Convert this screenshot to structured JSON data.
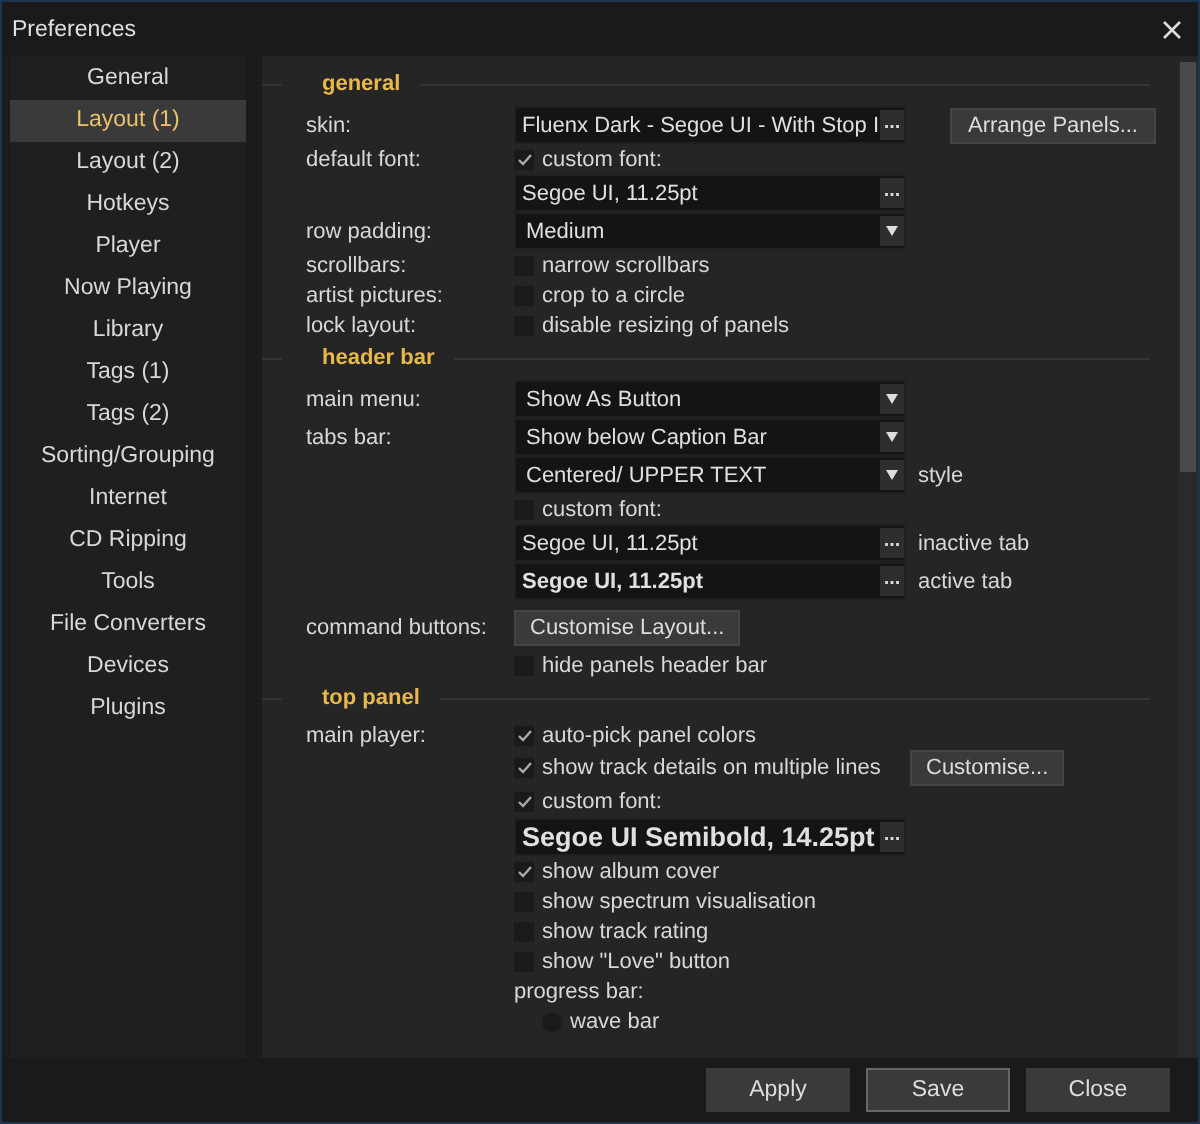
{
  "window": {
    "title": "Preferences"
  },
  "sidebar": {
    "items": [
      {
        "label": "General",
        "selected": false
      },
      {
        "label": "Layout (1)",
        "selected": true
      },
      {
        "label": "Layout (2)",
        "selected": false
      },
      {
        "label": "Hotkeys",
        "selected": false
      },
      {
        "label": "Player",
        "selected": false
      },
      {
        "label": "Now Playing",
        "selected": false
      },
      {
        "label": "Library",
        "selected": false
      },
      {
        "label": "Tags (1)",
        "selected": false
      },
      {
        "label": "Tags (2)",
        "selected": false
      },
      {
        "label": "Sorting/Grouping",
        "selected": false
      },
      {
        "label": "Internet",
        "selected": false
      },
      {
        "label": "CD Ripping",
        "selected": false
      },
      {
        "label": "Tools",
        "selected": false
      },
      {
        "label": "File Converters",
        "selected": false
      },
      {
        "label": "Devices",
        "selected": false
      },
      {
        "label": "Plugins",
        "selected": false
      }
    ]
  },
  "sections": [
    {
      "title": "general",
      "rows": [
        {
          "label": "skin:",
          "kind": "browse",
          "value": "Fluenx Dark - Segoe UI - With Stop I",
          "button": "...",
          "side_button": "Arrange Panels..."
        },
        {
          "label": "default font:",
          "kind": "checkbox",
          "text": "custom font:",
          "checked": true
        },
        {
          "kind": "browse",
          "value": "Segoe UI, 11.25pt",
          "button": "..."
        },
        {
          "label": "row padding:",
          "kind": "dropdown",
          "value": "Medium"
        },
        {
          "label": "scrollbars:",
          "kind": "checkbox",
          "text": "narrow scrollbars",
          "checked": false
        },
        {
          "label": "artist pictures:",
          "kind": "checkbox",
          "text": "crop to a circle",
          "checked": false
        },
        {
          "label": "lock layout:",
          "kind": "checkbox",
          "text": "disable resizing of panels",
          "checked": false
        }
      ]
    },
    {
      "title": "header bar",
      "rows": [
        {
          "label": "main menu:",
          "kind": "dropdown",
          "value": "Show As Button"
        },
        {
          "label": "tabs bar:",
          "kind": "dropdown",
          "value": "Show below Caption Bar"
        },
        {
          "kind": "dropdown",
          "value": "Centered/ UPPER TEXT",
          "side_text": "style"
        },
        {
          "kind": "checkbox",
          "text": "custom font:",
          "checked": false
        },
        {
          "kind": "browse",
          "value": "Segoe UI, 11.25pt",
          "button": "...",
          "side_text": "inactive tab"
        },
        {
          "kind": "browse-bold",
          "value": "Segoe UI, 11.25pt",
          "button": "...",
          "side_text": "active tab"
        },
        {
          "label": "command buttons:",
          "kind": "button",
          "text": "Customise Layout..."
        },
        {
          "kind": "checkbox",
          "text": "hide panels header bar",
          "checked": false
        }
      ]
    },
    {
      "title": "top panel",
      "rows": [
        {
          "label": "main player:",
          "kind": "checkbox",
          "text": "auto-pick panel colors",
          "checked": true
        },
        {
          "kind": "checkbox",
          "text": "show track details on multiple lines",
          "checked": true,
          "side_button": "Customise..."
        },
        {
          "kind": "checkbox",
          "text": "custom font:",
          "checked": true
        },
        {
          "kind": "browse-large",
          "value": "Segoe UI Semibold, 14.25pt",
          "button": "..."
        },
        {
          "kind": "checkbox",
          "text": "show album cover",
          "checked": true
        },
        {
          "kind": "checkbox",
          "text": "show spectrum visualisation",
          "checked": false
        },
        {
          "kind": "checkbox",
          "text": "show track rating",
          "checked": false
        },
        {
          "kind": "checkbox",
          "text": "show \"Love\" button",
          "checked": false
        },
        {
          "kind": "text",
          "text": "progress bar:"
        },
        {
          "kind": "radio",
          "text": "wave bar",
          "selected": false
        }
      ]
    }
  ],
  "buttons": [
    {
      "label": "Apply",
      "selected": false
    },
    {
      "label": "Save",
      "selected": true
    },
    {
      "label": "Close",
      "selected": false
    }
  ]
}
